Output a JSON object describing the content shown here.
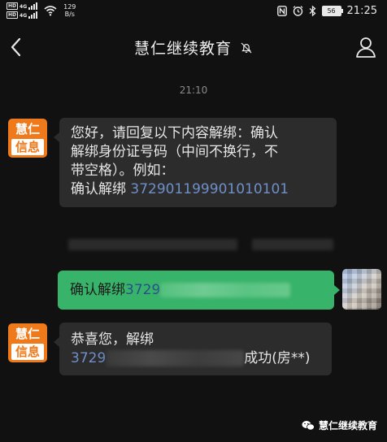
{
  "status_bar": {
    "sim1_tag": "HD",
    "sim2_tag": "HD",
    "network1": "4G",
    "network2": "4G",
    "speed_value": "129",
    "speed_unit": "B/s",
    "battery": "56",
    "time": "21:25"
  },
  "header": {
    "title": "慧仁继续教育"
  },
  "conversation": {
    "timestamp": "21:10",
    "sender_avatar_line1": "慧仁",
    "sender_avatar_line2": "信息",
    "message1": {
      "line1": "您好，请回复以下内容解绑：确认",
      "line2": "解绑身份证号码（中间不换行，不",
      "line3": "带空格）。例如：",
      "line4_text": "确认解绑 ",
      "line4_number": "372901199901010101"
    },
    "message2": {
      "text": "确认解绑 ",
      "number_prefix": "3729"
    },
    "message3": {
      "line1": "恭喜您，解绑",
      "number_prefix": "3729",
      "suffix": "成功(房**)"
    }
  },
  "watermark": {
    "text": "慧仁继续教育"
  },
  "colors": {
    "background": "#111111",
    "incoming_bubble": "#2c2c2c",
    "outgoing_bubble": "#38b36a",
    "avatar_orange": "#ee7a1b",
    "number_link": "#6f8fc9"
  }
}
